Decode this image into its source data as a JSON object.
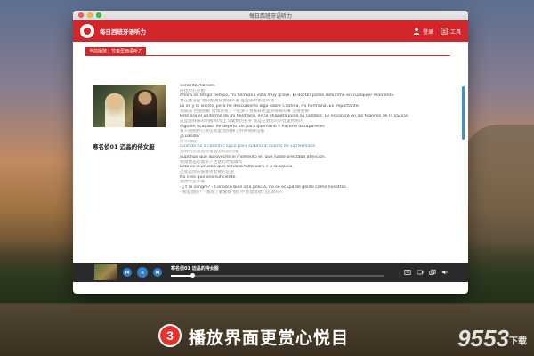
{
  "window": {
    "title": "每日西班牙语听力"
  },
  "app": {
    "name": "每日西班牙语听力",
    "login_label": "登录",
    "tools_label": "工具"
  },
  "now_playing": {
    "tag": "当前播放：节奏型西语听力",
    "episode_title": "寒名侦01 迈晶的侍女服"
  },
  "transcript": [
    {
      "text": "Señorita Alarcón.",
      "kind": "es"
    },
    {
      "text": "阿拉尔孔小姐",
      "kind": "zh"
    },
    {
      "text": "Ahora no tengo tiempo, mi hermana está muy grave. El doctor podía llamarme en cualquier momento.",
      "kind": "es"
    },
    {
      "text": "现在我没空 我的姐姐病情很严重 医生随时都会叫我",
      "kind": "zh"
    },
    {
      "text": "Lo sé y lo siento, pero he descubierto algo sobre Cristina, mi hermana. Es importante.",
      "kind": "es"
    },
    {
      "text": "我知道 也很抱歉 但我发现了一些关于我妹妹克里斯蒂娜的事 这很重要",
      "kind": "zh"
    },
    {
      "text": "Este era el uniforme de mi hermana, en la etiqueta pone su nombre. Lo encontré en los fogones de la cocina.",
      "kind": "es"
    },
    {
      "text": "这是我妹妹的制服 标签上写着她的名字 我是在厨房的炉灶里找到的",
      "kind": "zh"
    },
    {
      "text": "Alguien acababa de dejarlo ahí para quemarlo y hacerlo desaparecer.",
      "kind": "es"
    },
    {
      "text": "有人刚刚把它放在那里 想烧掉了好销毁掉证据",
      "kind": "zh"
    },
    {
      "text": "¿Cuándo?",
      "kind": "es"
    },
    {
      "text": "什么时候?",
      "kind": "zh"
    },
    {
      "text": "Cuando fui a calentar agua para subirla al cuarto de su hermana.",
      "kind": "active"
    },
    {
      "text": "我去烧水送到你姐姐房间的时候",
      "kind": "zh"
    },
    {
      "text": "Supongo que aprovechó el momento en que nadie prestaba atención.",
      "kind": "es"
    },
    {
      "text": "我猜他是趁着没人注意的时候做的",
      "kind": "zh"
    },
    {
      "text": "Esta es la prueba que le hacía falta para ir a la policía.",
      "kind": "es"
    },
    {
      "text": "这就是你去报警所需要的证据",
      "kind": "zh"
    },
    {
      "text": "No creo que sea suficiente.",
      "kind": "es"
    },
    {
      "text": "我觉得还不够",
      "kind": "zh"
    },
    {
      "text": "- ¿Y la sangre? - Conozco bien a la policía, no se ocupa de gente como nosotros.",
      "kind": "es"
    },
    {
      "text": "- 那些血呢？- 我很了解警察 他们不会理会我们这样的人",
      "kind": "zh"
    }
  ],
  "player": {
    "title": "寒名侦01 迈晶的侍女服",
    "progress": 0.1
  },
  "banner": {
    "badge": "3",
    "slogan": "播放界面更赏心悦目",
    "watermark": "9553",
    "watermark_suffix": "下载"
  },
  "colors": {
    "brand_red": "#d3262a",
    "accent_blue": "#3a8fd8"
  }
}
